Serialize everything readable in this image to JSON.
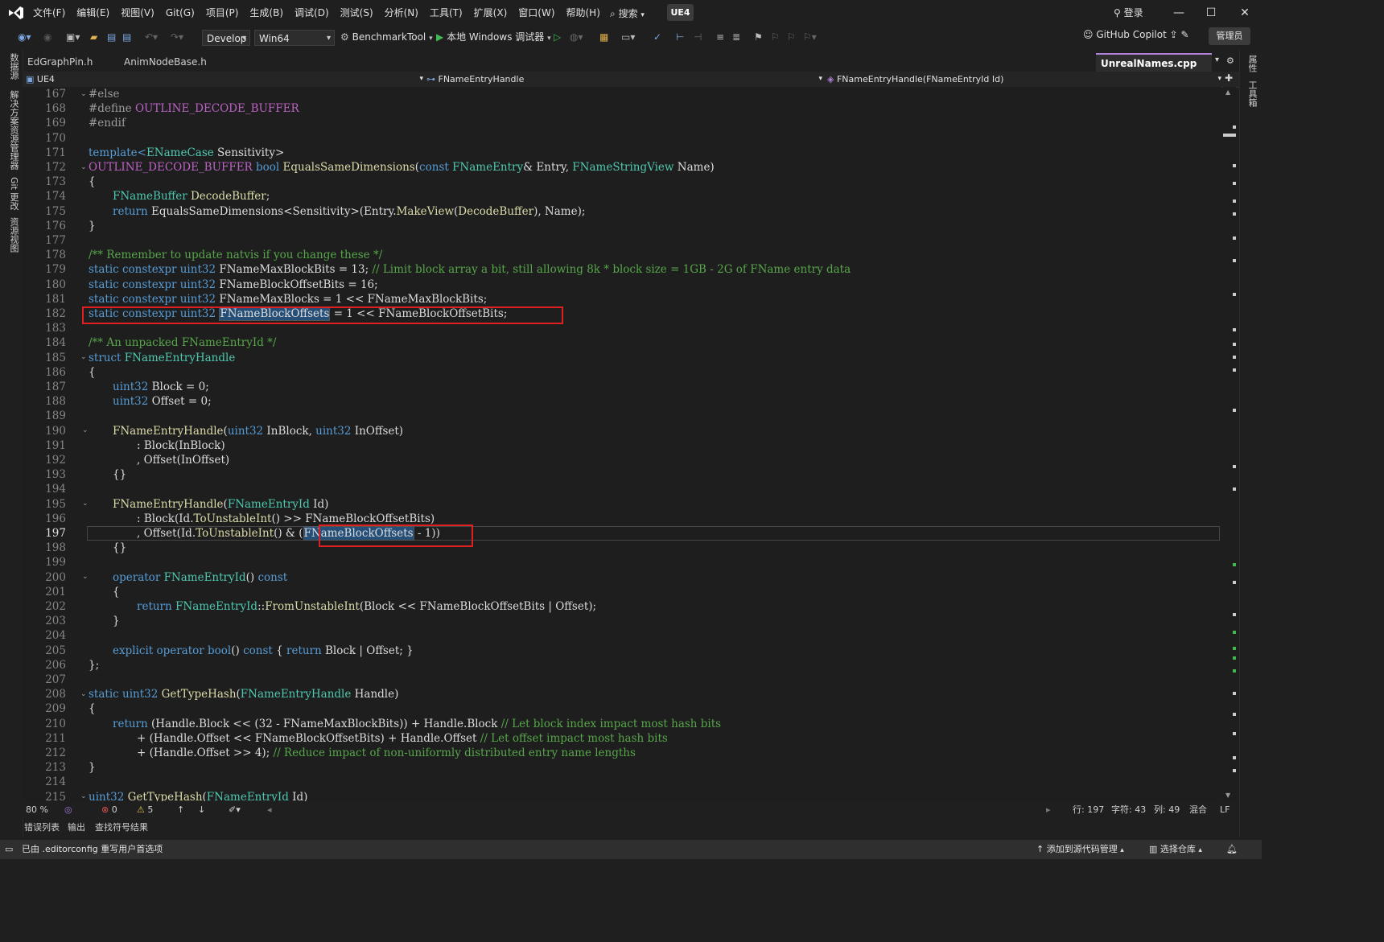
{
  "menu": [
    "文件(F)",
    "编辑(E)",
    "视图(V)",
    "Git(G)",
    "项目(P)",
    "生成(B)",
    "调试(D)",
    "测试(S)",
    "分析(N)",
    "工具(T)",
    "扩展(X)",
    "窗口(W)",
    "帮助(H)"
  ],
  "search_label": "搜索",
  "solution_badge": "UE4",
  "login_label": "登录",
  "toolbar": {
    "config": "Develop",
    "platform": "Win64",
    "startup_project": "BenchmarkTool",
    "debugger": "本地 Windows 调试器",
    "copilot": "GitHub Copilot",
    "admin": "管理员"
  },
  "left_sidebar": [
    "数据源",
    "解决方案资源管理器",
    "Git 更改",
    "资源视图"
  ],
  "right_sidebar": [
    "属性",
    "工具箱"
  ],
  "tabs": [
    {
      "label": "EdGraphPin.h"
    },
    {
      "label": "AnimNodeBase.h"
    },
    {
      "label": "UnrealNames.cpp"
    }
  ],
  "navbar": {
    "project": "UE4",
    "scope": "FNameEntryHandle",
    "member": "FNameEntryHandle(FNameEntryId Id)"
  },
  "line_numbers": [
    "167",
    "168",
    "169",
    "170",
    "171",
    "172",
    "173",
    "174",
    "175",
    "176",
    "177",
    "178",
    "179",
    "180",
    "181",
    "182",
    "183",
    "184",
    "185",
    "186",
    "187",
    "188",
    "189",
    "190",
    "191",
    "192",
    "193",
    "194",
    "195",
    "196",
    "197",
    "198",
    "199",
    "200",
    "201",
    "202",
    "203",
    "204",
    "205",
    "206",
    "207",
    "208",
    "209",
    "210",
    "211",
    "212",
    "213",
    "214",
    "215"
  ],
  "current_line": "197",
  "code_text": {
    "l167": "#else",
    "l168_a": "#define ",
    "l168_b": "OUTLINE_DECODE_BUFFER",
    "l169": "#endif",
    "l171_a": "template<",
    "l171_b": "ENameCase",
    "l171_c": " Sensitivity>",
    "l172_a": "OUTLINE_DECODE_BUFFER",
    "l172_b": " bool ",
    "l172_c": "EqualsSameDimensions",
    "l172_d": "(",
    "l172_e": "const ",
    "l172_f": "FNameEntry",
    "l172_g": "& Entry, ",
    "l172_h": "FNameStringView",
    "l172_i": " Name)",
    "l173": "{",
    "l174_a": "FNameBuffer",
    "l174_b": " DecodeBuffer",
    "l174_c": ";",
    "l175_a": "return ",
    "l175_b": "EqualsSameDimensions",
    "l175_c": "<Sensitivity>(Entry.",
    "l175_d": "MakeView",
    "l175_e": "(",
    "l175_f": "DecodeBuffer",
    "l175_g": "), Name);",
    "l176": "}",
    "l178": "/** Remember to update natvis if you change these */",
    "l179_a": "static constexpr ",
    "l179_b": "uint32",
    "l179_c": " FNameMaxBlockBits = 13; ",
    "l179_d": "// Limit block array a bit, still allowing 8k * block size = 1GB - 2G of FName entry data",
    "l180_a": "static constexpr ",
    "l180_b": "uint32",
    "l180_c": " FNameBlockOffsetBits = 16;",
    "l181_a": "static constexpr ",
    "l181_b": "uint32",
    "l181_c": " FNameMaxBlocks = 1 << FNameMaxBlockBits;",
    "l182_a": "static constexpr ",
    "l182_b": "uint32",
    "l182_c": " ",
    "l182_d": "FNameBlockOffsets",
    "l182_e": " = 1 << FNameBlockOffsetBits;",
    "l184": "/** An unpacked FNameEntryId */",
    "l185_a": "struct ",
    "l185_b": "FNameEntryHandle",
    "l186": "{",
    "l187_a": "uint32",
    "l187_b": " Block = 0;",
    "l188_a": "uint32",
    "l188_b": " Offset = 0;",
    "l190_a": "FNameEntryHandle",
    "l190_b": "(",
    "l190_c": "uint32",
    "l190_d": " InBlock, ",
    "l190_e": "uint32",
    "l190_f": " InOffset)",
    "l191": ": Block(InBlock)",
    "l192": ", Offset(InOffset)",
    "l193": "{}",
    "l195_a": "FNameEntryHandle",
    "l195_b": "(",
    "l195_c": "FNameEntryId",
    "l195_d": " Id)",
    "l196_a": ": Block(Id.",
    "l196_b": "ToUnstableInt",
    "l196_c": "() >> FNameBlockOffsetBits)",
    "l197_a": ", Offset(Id.",
    "l197_b": "ToUnstableInt",
    "l197_c": "() & (",
    "l197_d": "FNameBlockOffsets",
    "l197_e": " - 1))",
    "l198": "{}",
    "l200_a": "operator ",
    "l200_b": "FNameEntryId",
    "l200_c": "() ",
    "l200_d": "const",
    "l201": "{",
    "l202_a": "return ",
    "l202_b": "FNameEntryId",
    "l202_c": "::",
    "l202_d": "FromUnstableInt",
    "l202_e": "(Block << FNameBlockOffsetBits | Offset);",
    "l203": "}",
    "l205_a": "explicit operator bool",
    "l205_b": "() ",
    "l205_c": "const",
    "l205_d": " { ",
    "l205_e": "return",
    "l205_f": " Block | Offset; }",
    "l206": "};",
    "l208_a": "static ",
    "l208_b": "uint32",
    "l208_c": " ",
    "l208_d": "GetTypeHash",
    "l208_e": "(",
    "l208_f": "FNameEntryHandle",
    "l208_g": " Handle)",
    "l209": "{",
    "l210_a": "return",
    "l210_b": " (Handle.Block << (32 - FNameMaxBlockBits)) + Handle.Block ",
    "l210_c": "// Let block index impact most hash bits",
    "l211_a": "+ (Handle.Offset << FNameBlockOffsetBits) + Handle.Offset ",
    "l211_b": "// Let offset impact most hash bits",
    "l212_a": "+ (Handle.Offset >> 4); ",
    "l212_b": "// Reduce impact of non-uniformly distributed entry name lengths",
    "l213": "}",
    "l215_a": "uint32",
    "l215_b": " ",
    "l215_c": "GetTypeHash",
    "l215_d": "(",
    "l215_e": "FNameEntryId",
    "l215_f": " Id)"
  },
  "status_row": {
    "zoom": "80 %",
    "errors": "0",
    "warnings": "5",
    "line": "行: 197",
    "char": "字符: 43",
    "col": "列: 49",
    "indent": "混合",
    "eol": "LF"
  },
  "bottom_tabs": [
    "错误列表",
    "输出",
    "查找符号结果"
  ],
  "statusbar": {
    "message": "已由 .editorconfig 重写用户首选项",
    "source_control": "添加到源代码管理",
    "repo": "选择仓库"
  },
  "colors": {
    "background": "#1e1e1e",
    "keyword": "#569cd6",
    "type": "#4ec9b0",
    "function": "#dcdcaa",
    "comment": "#57a64a",
    "macro": "#bd63c5",
    "highlight": "#264f78",
    "annotation_box": "#e02020"
  }
}
